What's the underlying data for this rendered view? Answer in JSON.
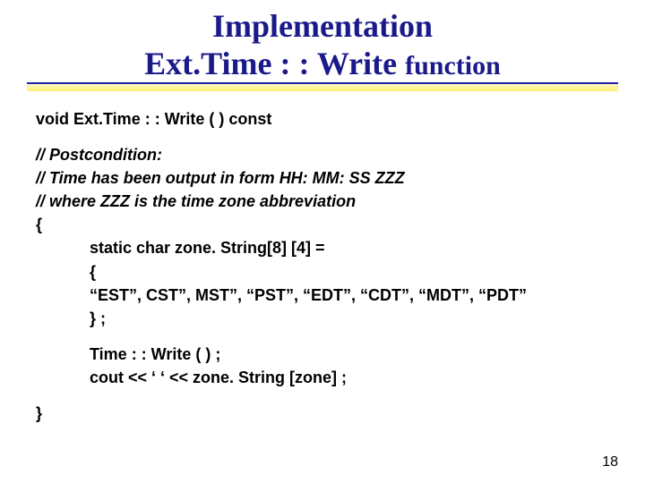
{
  "title": {
    "line1": "Implementation",
    "line2_a": "Ext.Time : :  Write ",
    "line2_b": "function"
  },
  "signature": "void  Ext.Time : : Write (   )   const",
  "postcond": {
    "l1": "//  Postcondition:",
    "l2": "//            Time has been output in form HH: MM: SS  ZZZ",
    "l3": "//            where  ZZZ is the time zone abbreviation"
  },
  "brace_open": "{",
  "body": {
    "l1": "static  char  zone. String[8] [4]  =",
    "l2": "{",
    "l3": "  “EST”, CST”, MST”, “PST”, “EDT”, “CDT”, “MDT”, “PDT”",
    "l4": "} ;"
  },
  "calls": {
    "l1": "Time : : Write ( ) ;",
    "l2": "cout  << ‘ ‘ <<  zone. String [zone] ;"
  },
  "brace_close": "}",
  "pagenum": "18"
}
